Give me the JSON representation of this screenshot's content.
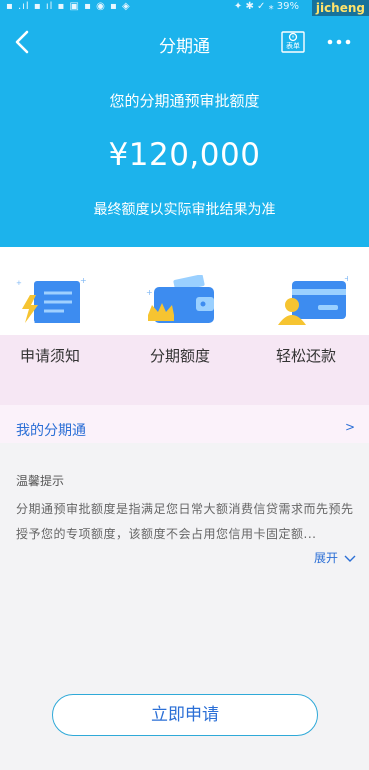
{
  "status_bar": {
    "left": "▪ .ıl ▪ ıl ▪ ▣ ▪ ◉ ▪ ◈",
    "right": "✦ ✱ ✓ ⁎ 39%"
  },
  "watermark": "jicheng",
  "nav": {
    "title": "分期通",
    "form_badge": "表单"
  },
  "hero": {
    "label": "您的分期通预审批额度",
    "amount": "¥120,000",
    "note": "最终额度以实际审批结果为准"
  },
  "features": [
    {
      "label": "申请须知",
      "icon": "receipt-lightning-icon"
    },
    {
      "label": "分期额度",
      "icon": "wallet-crown-icon"
    },
    {
      "label": "轻松还款",
      "icon": "card-person-icon"
    }
  ],
  "my_section": {
    "label": "我的分期通",
    "arrow": ">"
  },
  "tips": {
    "title": "温馨提示",
    "body": "分期通预审批额度是指满足您日常大额消费信贷需求而先预先授予您的专项额度，该额度不会占用您信用卡固定额...",
    "expand": "展开"
  },
  "apply_button": "立即申请",
  "colors": {
    "hero_bg": "#1cb3ec",
    "accent_blue": "#2b6fd6"
  }
}
